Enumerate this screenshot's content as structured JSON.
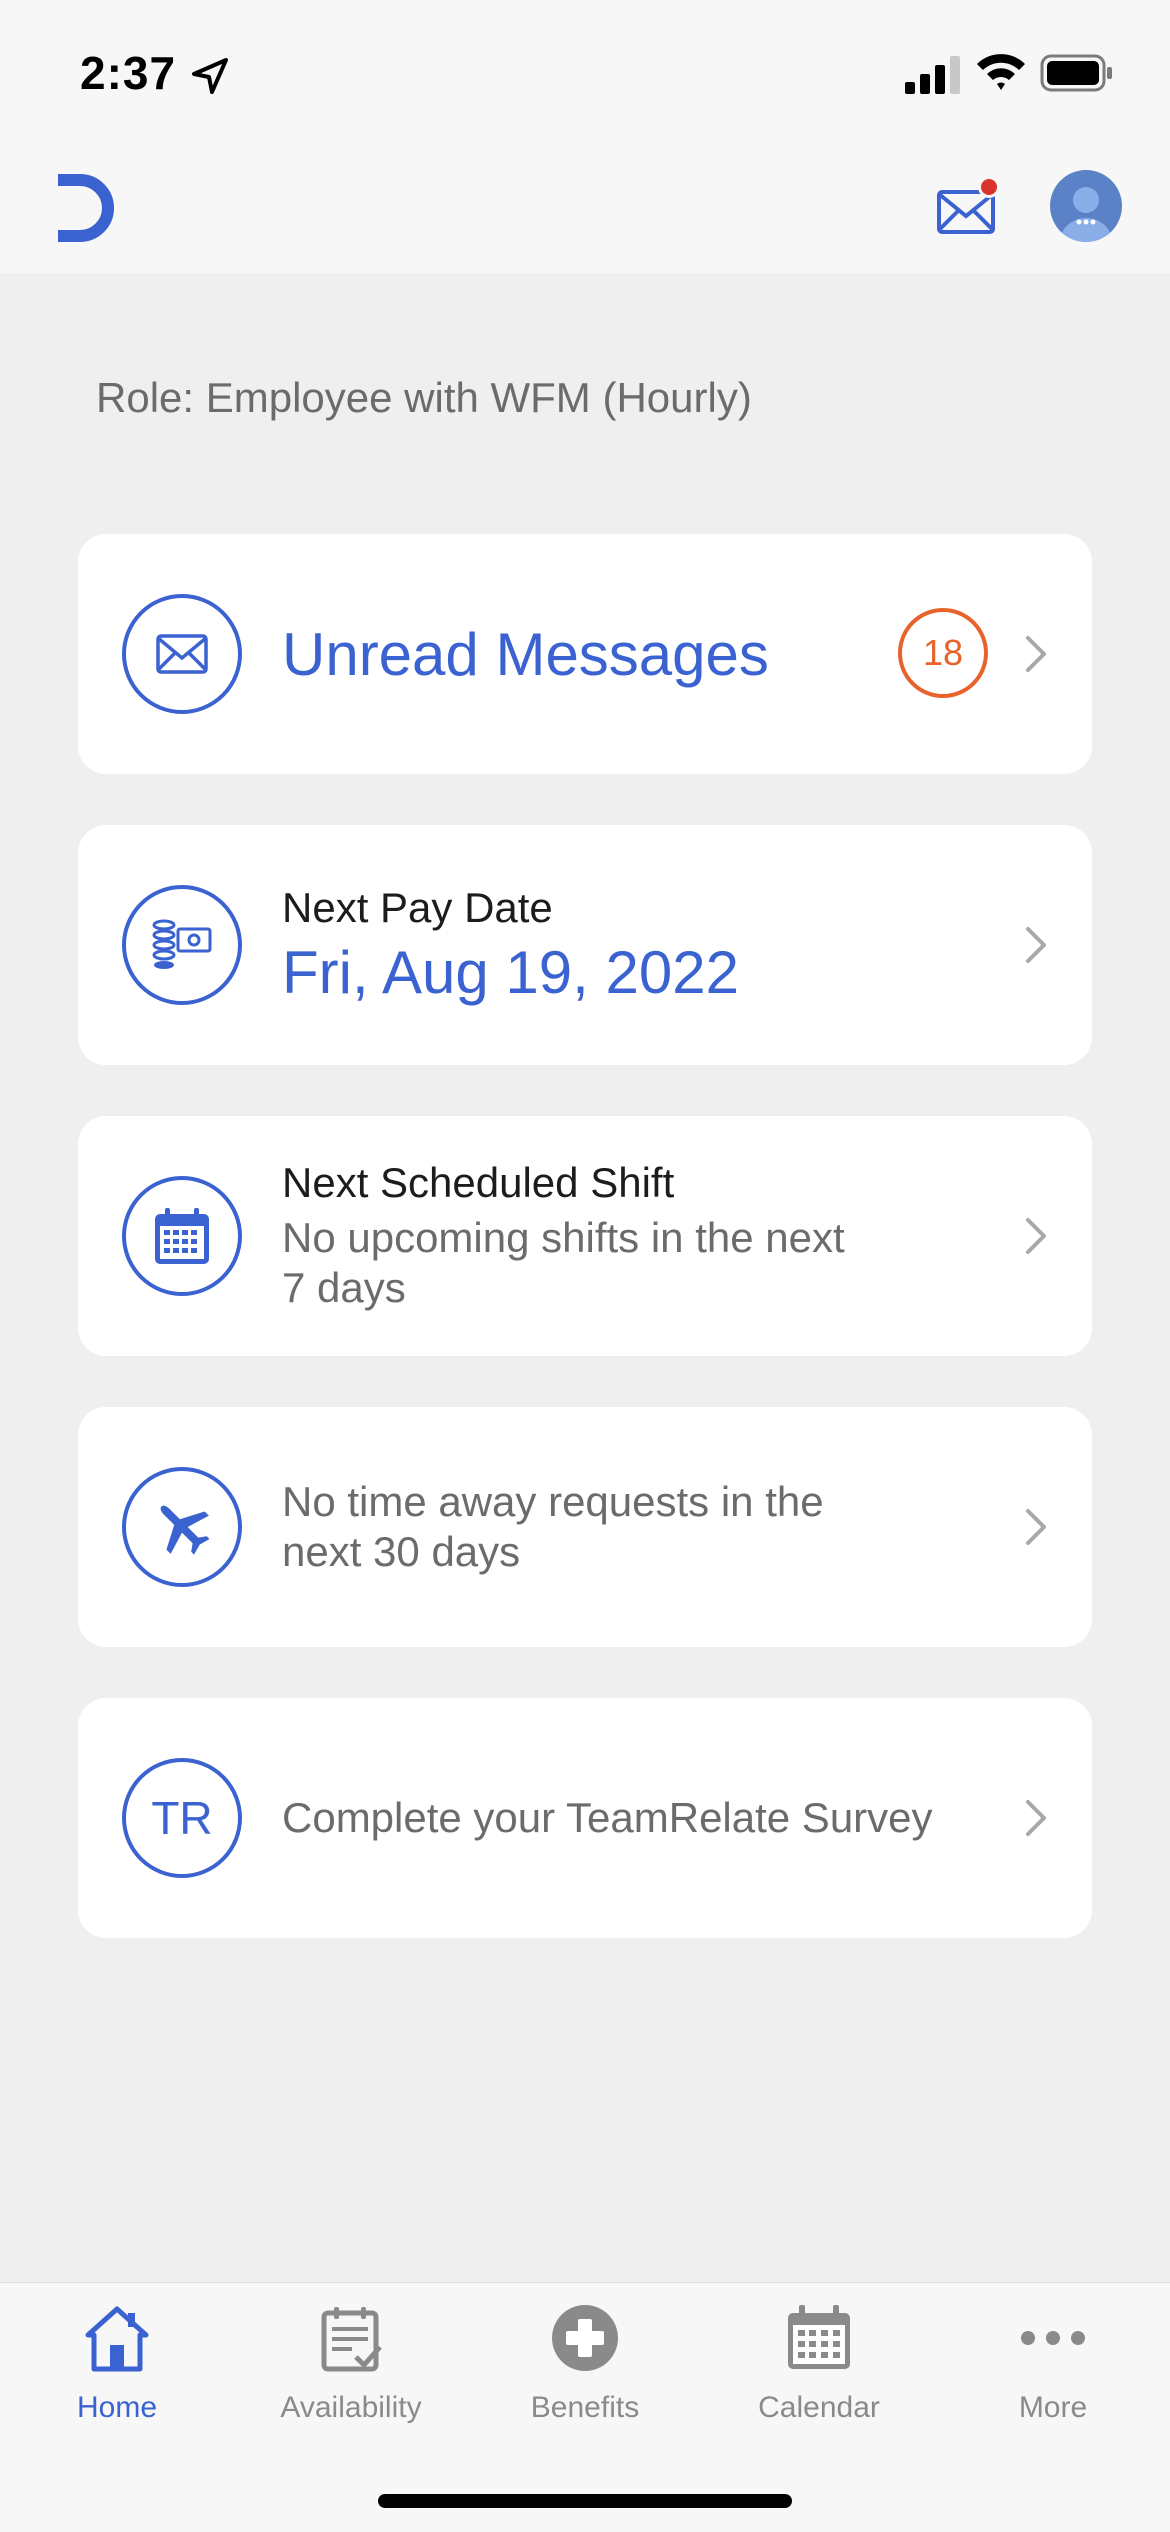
{
  "status_bar": {
    "time": "2:37"
  },
  "header": {
    "logo_icon": "brand-logo-icon",
    "mail_icon": "mail-icon",
    "avatar_icon": "avatar-icon"
  },
  "role": "Role: Employee with WFM (Hourly)",
  "cards": {
    "messages": {
      "title": "Unread Messages",
      "count": "18",
      "icon": "envelope-icon"
    },
    "pay": {
      "label": "Next Pay Date",
      "value": "Fri, Aug 19, 2022",
      "icon": "money-icon"
    },
    "shift": {
      "label": "Next Scheduled Shift",
      "value_line1": "No upcoming shifts in the next",
      "value_line2": "7 days",
      "icon": "calendar-icon"
    },
    "time_away": {
      "line1": "No time away requests in the",
      "line2": "next 30 days",
      "icon": "airplane-icon"
    },
    "survey": {
      "badge": "TR",
      "text": "Complete your TeamRelate Survey"
    }
  },
  "tabs": [
    {
      "label": "Home",
      "icon": "home-icon",
      "active": true
    },
    {
      "label": "Availability",
      "icon": "availability-icon",
      "active": false
    },
    {
      "label": "Benefits",
      "icon": "benefits-icon",
      "active": false
    },
    {
      "label": "Calendar",
      "icon": "calendar-icon",
      "active": false
    },
    {
      "label": "More",
      "icon": "more-icon",
      "active": false
    }
  ],
  "colors": {
    "accent": "#3a62d0",
    "badge": "#e8622c",
    "notification": "#d9342b"
  }
}
